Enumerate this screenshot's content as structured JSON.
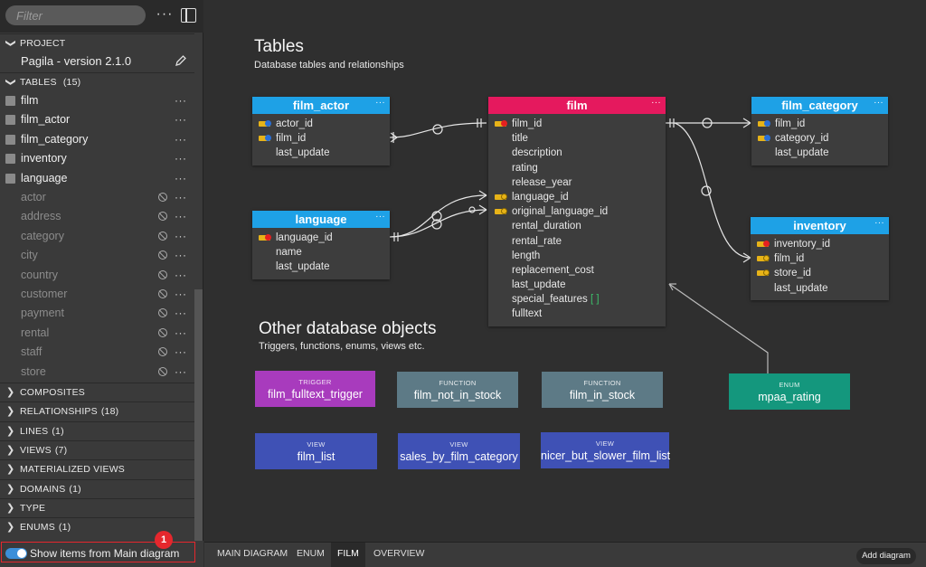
{
  "sidebar": {
    "filter_placeholder": "Filter",
    "more_label": "···",
    "project_section": "PROJECT",
    "project_name": "Pagila - version 2.1.0",
    "tables_section": "TABLES",
    "tables_count": "(15)",
    "visible_tables": [
      "film",
      "film_actor",
      "film_category",
      "inventory",
      "language"
    ],
    "hidden_tables": [
      "actor",
      "address",
      "category",
      "city",
      "country",
      "customer",
      "payment",
      "rental",
      "staff",
      "store"
    ],
    "sections": [
      {
        "label": "COMPOSITES",
        "count": ""
      },
      {
        "label": "RELATIONSHIPS",
        "count": "(18)"
      },
      {
        "label": "LINES",
        "count": "(1)"
      },
      {
        "label": "VIEWS",
        "count": "(7)"
      },
      {
        "label": "MATERIALIZED VIEWS",
        "count": ""
      },
      {
        "label": "DOMAINS",
        "count": "(1)"
      },
      {
        "label": "TYPE",
        "count": ""
      },
      {
        "label": "ENUMS",
        "count": "(1)"
      }
    ],
    "toggle_label": "Show items from Main diagram",
    "badge": "1"
  },
  "canvas": {
    "tables_heading": "Tables",
    "tables_subheading": "Database tables and relationships",
    "other_heading": "Other database objects",
    "other_subheading": "Triggers, functions, enums, views etc.",
    "tables": {
      "film_actor": {
        "title": "film_actor",
        "color": "#1ea1e6",
        "columns": [
          "actor_id",
          "film_id",
          "last_update"
        ]
      },
      "film": {
        "title": "film",
        "color": "#e5195e",
        "columns": [
          "film_id",
          "title",
          "description",
          "rating",
          "release_year",
          "language_id",
          "original_language_id",
          "rental_duration",
          "rental_rate",
          "length",
          "replacement_cost",
          "last_update",
          "special_features",
          "fulltext"
        ],
        "array_suffix": "[ ]"
      },
      "film_category": {
        "title": "film_category",
        "color": "#1ea1e6",
        "columns": [
          "film_id",
          "category_id",
          "last_update"
        ]
      },
      "language": {
        "title": "language",
        "color": "#1ea1e6",
        "columns": [
          "language_id",
          "name",
          "last_update"
        ]
      },
      "inventory": {
        "title": "inventory",
        "color": "#1ea1e6",
        "columns": [
          "inventory_id",
          "film_id",
          "store_id",
          "last_update"
        ]
      }
    },
    "objects": [
      {
        "kind": "TRIGGER",
        "name": "film_fulltext_trigger",
        "color": "#a83bbd"
      },
      {
        "kind": "FUNCTION",
        "name": "film_not_in_stock",
        "color": "#5d7a86"
      },
      {
        "kind": "FUNCTION",
        "name": "film_in_stock",
        "color": "#5d7a86"
      },
      {
        "kind": "ENUM",
        "name": "mpaa_rating",
        "color": "#14977d"
      },
      {
        "kind": "VIEW",
        "name": "film_list",
        "color": "#3f51b5"
      },
      {
        "kind": "VIEW",
        "name": "sales_by_film_category",
        "color": "#3f51b5"
      },
      {
        "kind": "VIEW",
        "name": "nicer_but_slower_film_list",
        "color": "#3f51b5"
      }
    ],
    "table_menu": "···"
  },
  "tabbar": {
    "tabs": [
      "MAIN DIAGRAM",
      "ENUM",
      "FILM",
      "OVERVIEW"
    ],
    "active_tab": "FILM",
    "add_label": "Add diagram"
  }
}
